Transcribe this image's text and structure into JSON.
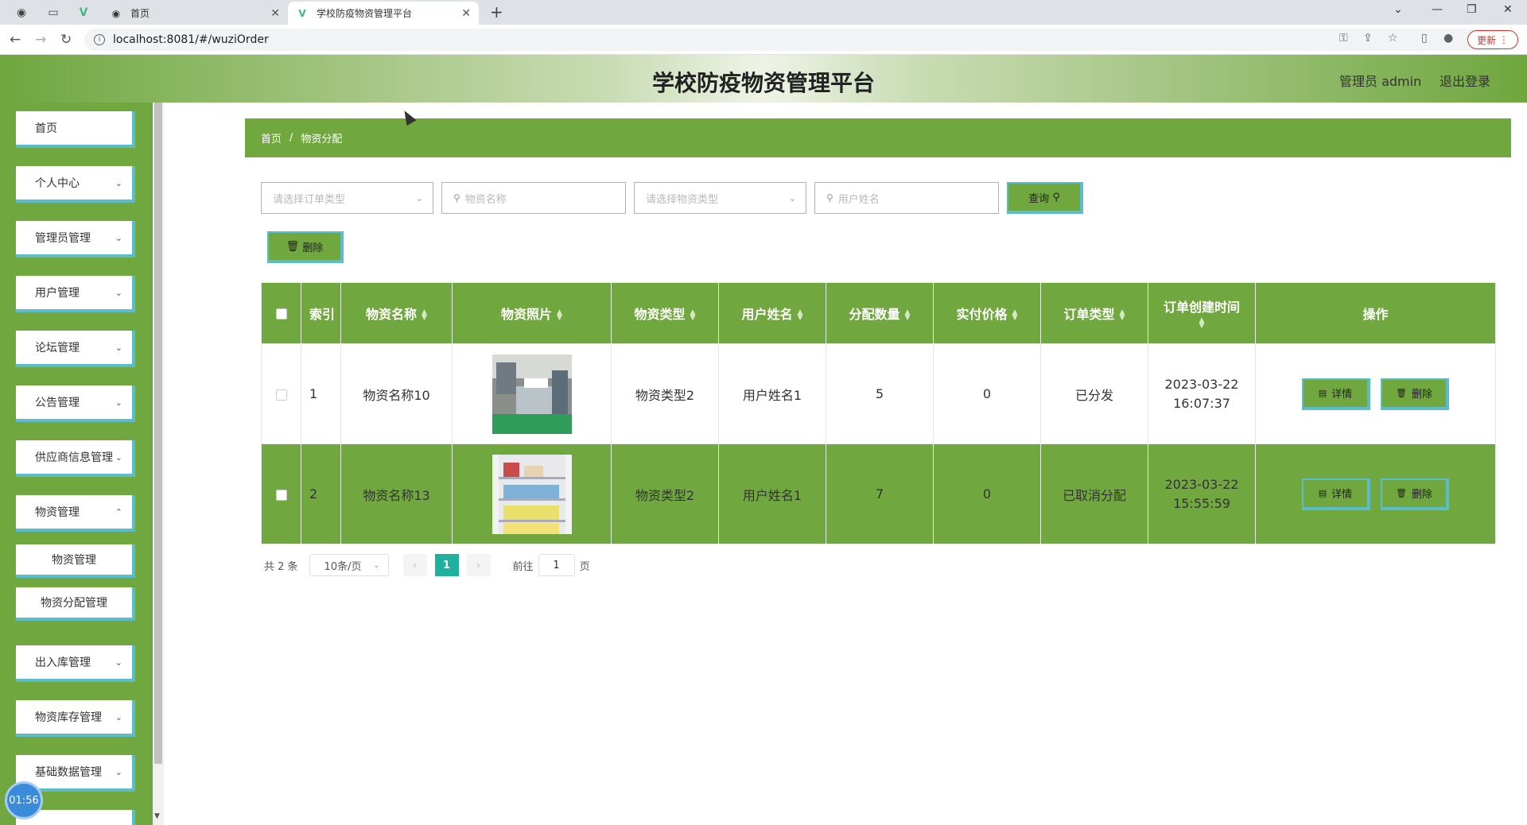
{
  "browser": {
    "tabs": [
      {
        "label": "首页"
      },
      {
        "label": "学校防疫物资管理平台"
      }
    ],
    "url": "localhost:8081/#/wuziOrder",
    "update_label": "更新"
  },
  "header": {
    "title": "学校防疫物资管理平台",
    "admin": "管理员 admin",
    "logout": "退出登录"
  },
  "sidebar": {
    "items": [
      {
        "label": "首页"
      },
      {
        "label": "个人中心"
      },
      {
        "label": "管理员管理"
      },
      {
        "label": "用户管理"
      },
      {
        "label": "论坛管理"
      },
      {
        "label": "公告管理"
      },
      {
        "label": "供应商信息管理"
      },
      {
        "label": "物资管理"
      }
    ],
    "sub_items": [
      {
        "label": "物资管理"
      },
      {
        "label": "物资分配管理"
      }
    ],
    "items_after": [
      {
        "label": "出入库管理"
      },
      {
        "label": "物资库存管理"
      },
      {
        "label": "基础数据管理"
      }
    ],
    "timer": "01:56"
  },
  "breadcrumb": {
    "home": "首页",
    "current": "物资分配"
  },
  "filters": {
    "order_type_placeholder": "请选择订单类型",
    "name_placeholder": "物资名称",
    "material_type_placeholder": "请选择物资类型",
    "user_placeholder": "用户姓名",
    "query_label": "查询",
    "delete_label": "删除"
  },
  "table": {
    "headers": [
      "索引",
      "物资名称",
      "物资照片",
      "物资类型",
      "用户姓名",
      "分配数量",
      "实付价格",
      "订单类型",
      "订单创建时间",
      "操作"
    ],
    "rows": [
      {
        "index": "1",
        "name": "物资名称10",
        "type": "物资类型2",
        "user": "用户姓名1",
        "qty": "5",
        "price": "0",
        "order_type": "已分发",
        "created": "2023-03-22 16:07:37"
      },
      {
        "index": "2",
        "name": "物资名称13",
        "type": "物资类型2",
        "user": "用户姓名1",
        "qty": "7",
        "price": "0",
        "order_type": "已取消分配",
        "created": "2023-03-22 15:55:59"
      }
    ],
    "detail_label": "详情",
    "delete_label": "删除"
  },
  "pagination": {
    "total": "共 2 条",
    "page_size": "10条/页",
    "current_page": "1",
    "goto_label": "前往",
    "goto_value": "1",
    "page_unit": "页"
  },
  "colors": {
    "brand_green": "#70a83f",
    "accent_cyan": "#5bbdc9",
    "pager_active": "#1fb19e"
  }
}
